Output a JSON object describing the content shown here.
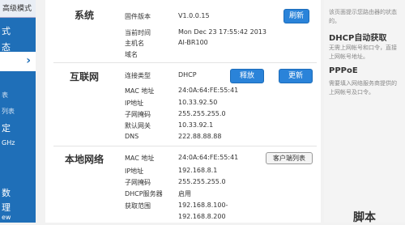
{
  "sidebar": {
    "top_button": "高级模式",
    "items": [
      "式",
      "态",
      "表",
      "列表",
      "定",
      "GHz",
      "数",
      "理",
      "ew"
    ]
  },
  "system": {
    "title": "系统",
    "refresh_label": "刷新",
    "rows": [
      {
        "label": "固件版本",
        "value": "V1.0.0.15"
      },
      {
        "label": "当前时间",
        "value": "Mon Dec 23 17:55:42 2013"
      },
      {
        "label": "主机名",
        "value": "AI-BR100"
      },
      {
        "label": "域名",
        "value": ""
      }
    ]
  },
  "internet": {
    "title": "互联网",
    "release_label": "释放",
    "renew_label": "更新",
    "rows": [
      {
        "label": "连接类型",
        "value": "DHCP"
      },
      {
        "label": "MAC 地址",
        "value": "24:0A:64:FE:55:41"
      },
      {
        "label": "IP地址",
        "value": "10.33.92.50"
      },
      {
        "label": "子网掩码",
        "value": "255.255.255.0"
      },
      {
        "label": "默认网关",
        "value": "10.33.92.1"
      },
      {
        "label": "DNS",
        "value": "222.88.88.88"
      }
    ]
  },
  "lan": {
    "title": "本地网络",
    "client_list_label": "客户端列表",
    "rows": [
      {
        "label": "MAC 地址",
        "value": "24:0A:64:FE:55:41"
      },
      {
        "label": "IP地址",
        "value": "192.168.8.1"
      },
      {
        "label": "子网掩码",
        "value": "255.255.255.0"
      },
      {
        "label": "DHCP服务器",
        "value": "启用"
      },
      {
        "label": "获取范围",
        "value": "192.168.8.100-"
      },
      {
        "label": "",
        "value": "192.168.8.200"
      }
    ]
  },
  "help": {
    "line1": "该页面提示您路由器的状态",
    "line2": "的。",
    "dhcp_title": "DHCP自动获取",
    "dhcp_text1": "无需上网帐号和口令，直接",
    "dhcp_text2": "上网帐号地址。",
    "pppoe_title": "PPPoE",
    "pppoe_text1": "需要填入网络服务商提供的",
    "pppoe_text2": "上网帐号及口令。"
  },
  "brand_partial": "脚本"
}
